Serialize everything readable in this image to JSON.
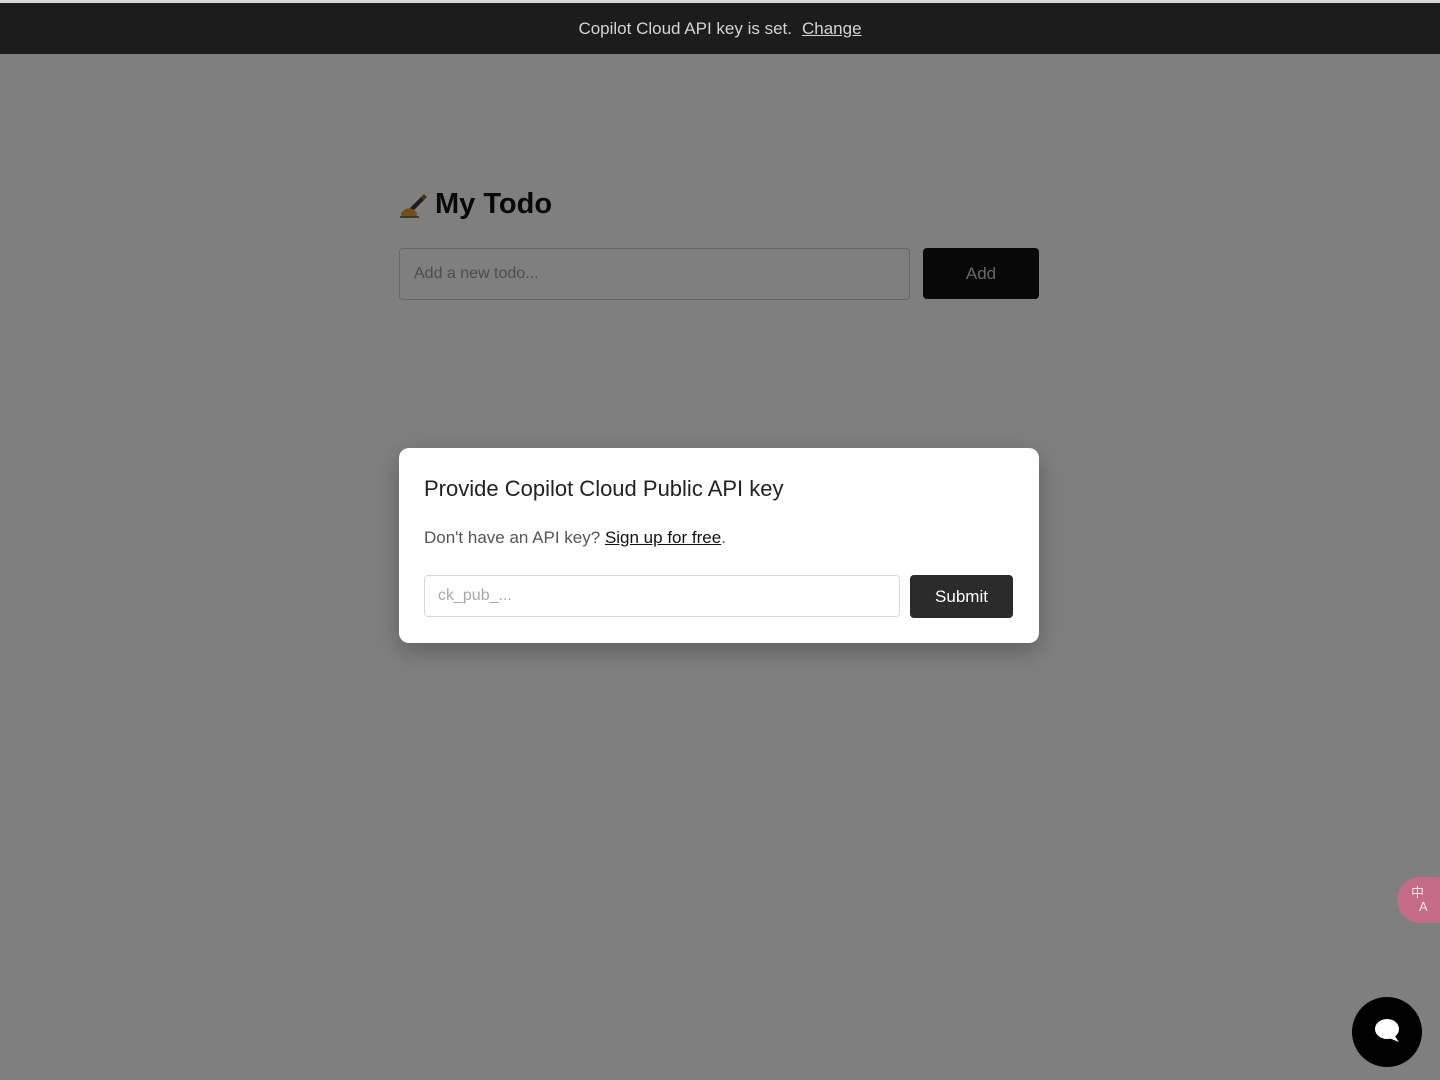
{
  "banner": {
    "message": "Copilot Cloud API key is set.",
    "change_label": "Change"
  },
  "app": {
    "title": "My Todo",
    "title_icon": "writing-hand-icon",
    "todo_input_placeholder": "Add a new todo...",
    "add_label": "Add"
  },
  "modal": {
    "title": "Provide Copilot Cloud Public API key",
    "prompt": "Don't have an API key?",
    "signup_label": "Sign up for free",
    "signup_suffix": ".",
    "key_input_placeholder": "ck_pub_...",
    "submit_label": "Submit"
  },
  "widgets": {
    "translate_icon": "translate-icon",
    "translate_glyph_top": "中",
    "translate_glyph_bottom": "A",
    "chat_icon": "chat-bubble-icon"
  },
  "colors": {
    "banner_bg": "#1c1c1c",
    "button_dark": "#111111",
    "submit_bg": "#2b2b2b",
    "translate_bg": "#c46b86",
    "overlay": "rgba(0,0,0,0.5)"
  }
}
